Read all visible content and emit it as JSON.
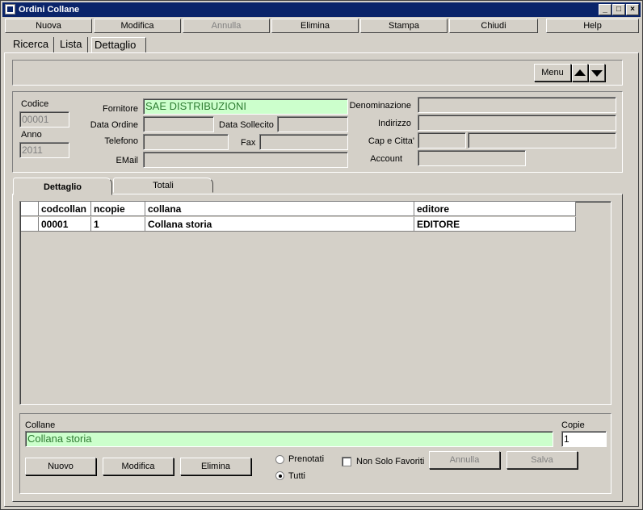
{
  "window": {
    "title": "Ordini Collane"
  },
  "toolbar": {
    "nuova": "Nuova",
    "modifica": "Modifica",
    "annulla": "Annulla",
    "elimina": "Elimina",
    "stampa": "Stampa",
    "chiudi": "Chiudi",
    "help": "Help"
  },
  "page_tabs": [
    "Ricerca",
    "Lista",
    "Dettaglio"
  ],
  "menu_label": "Menu",
  "header": {
    "codice_label": "Codice",
    "codice_value": "00001",
    "anno_label": "Anno",
    "anno_value": "2011",
    "fornitore_label": "Fornitore",
    "fornitore_value": "SAE DISTRIBUZIONI",
    "data_ordine_label": "Data Ordine",
    "data_sollecito_label": "Data Sollecito",
    "telefono_label": "Telefono",
    "fax_label": "Fax",
    "email_label": "EMail",
    "denominazione_label": "Denominazione",
    "indirizzo_label": "Indirizzo",
    "cap_citta_label": "Cap e Citta'",
    "account_label": "Account"
  },
  "inner_tabs": [
    "Dettaglio",
    "Totali"
  ],
  "grid": {
    "columns": [
      "codcollan",
      "ncopie",
      "collana",
      "editore"
    ],
    "rows": [
      [
        "00001",
        "1",
        "Collana storia",
        "EDITORE"
      ]
    ]
  },
  "detail": {
    "collane_label": "Collane",
    "collane_value": "Collana storia",
    "copie_label": "Copie",
    "copie_value": "1",
    "nuovo": "Nuovo",
    "modifica": "Modifica",
    "elimina": "Elimina",
    "prenotati": "Prenotati",
    "tutti": "Tutti",
    "non_solo_favoriti": "Non Solo Favoriti",
    "annulla": "Annulla",
    "salva": "Salva"
  }
}
